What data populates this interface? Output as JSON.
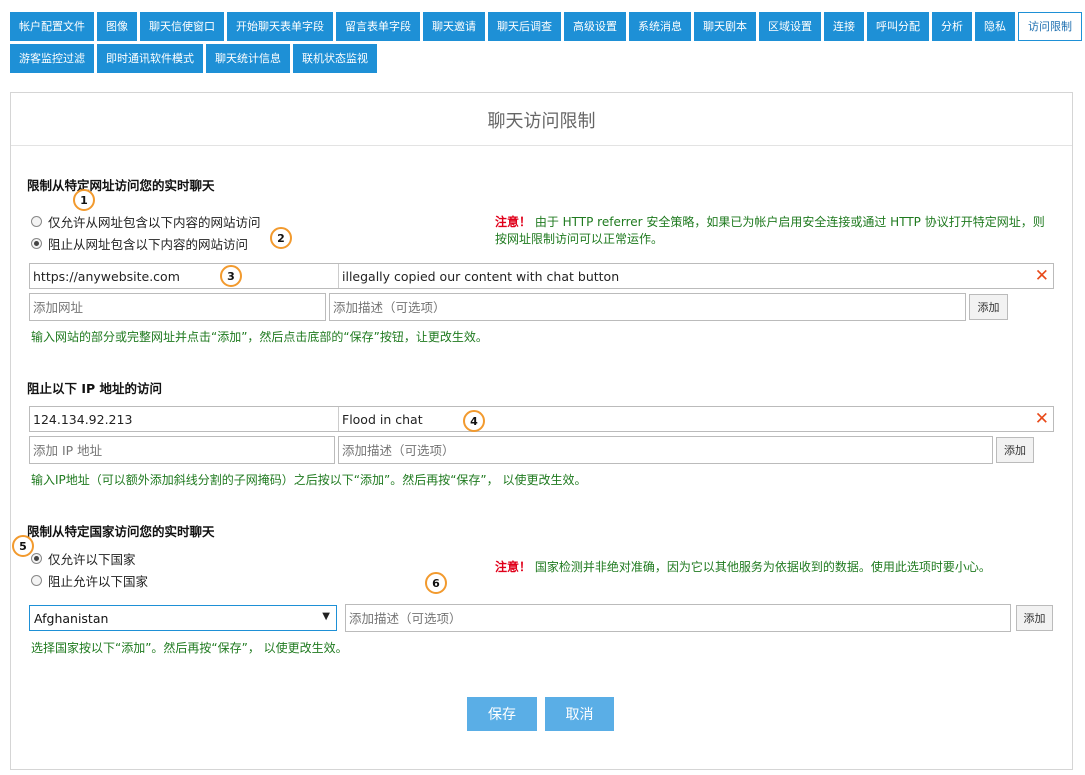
{
  "tabs_row1": [
    "帐户配置文件",
    "图像",
    "聊天信使窗口",
    "开始聊天表单字段",
    "留言表单字段",
    "聊天邀请",
    "聊天后调查",
    "高级设置",
    "系统消息",
    "聊天剧本",
    "区域设置",
    "连接",
    "呼叫分配",
    "分析",
    "隐私",
    "访问限制"
  ],
  "tabs_row2": [
    "游客监控过滤",
    "即时通讯软件模式",
    "聊天统计信息",
    "联机状态监视"
  ],
  "page_title": "聊天访问限制",
  "url_section": {
    "title": "限制从特定网址访问您的实时聊天",
    "option_allow": "仅允许从网址包含以下内容的网站访问",
    "option_block": "阻止从网址包含以下内容的网站访问",
    "note_warn": "注意！",
    "note_text": "由于 HTTP referrer 安全策略，如果已为帐户启用安全连接或通过 HTTP 协议打开特定网址，则按网址限制访问可以正常运作。",
    "entry_url": "https://anywebsite.com",
    "entry_desc": "illegally copied our content with chat button",
    "url_placeholder": "添加网址",
    "desc_placeholder": "添加描述（可选项）",
    "add_label": "添加",
    "help": "输入网站的部分或完整网址并点击“添加”，然后点击底部的“保存”按钮，让更改生效。"
  },
  "ip_section": {
    "title": "阻止以下 IP 地址的访问",
    "entry_ip": "124.134.92.213",
    "entry_desc": "Flood in chat",
    "ip_placeholder": "添加 IP 地址",
    "desc_placeholder": "添加描述（可选项）",
    "add_label": "添加",
    "help": "输入IP地址（可以额外添加斜线分割的子网掩码）之后按以下“添加”。然后再按“保存”， 以使更改生效。"
  },
  "country_section": {
    "title": "限制从特定国家访问您的实时聊天",
    "option_allow": "仅允许以下国家",
    "option_block": "阻止允许以下国家",
    "note_warn": "注意！",
    "note_text": "国家检测并非绝对准确，因为它以其他服务为依据收到的数据。使用此选项时要小心。",
    "selected_country": "Afghanistan",
    "desc_placeholder": "添加描述（可选项）",
    "add_label": "添加",
    "help": "选择国家按以下“添加”。然后再按“保存”， 以使更改生效。"
  },
  "save_label": "保存",
  "cancel_label": "取消",
  "delete_icon": "✕",
  "caret_icon": "▼",
  "markers": [
    "1",
    "2",
    "3",
    "4",
    "5",
    "6"
  ],
  "colors": {
    "tab_blue": "#1e90d6",
    "button_blue": "#5aaee6",
    "note_green": "#1f7a1f",
    "warn_red": "#e0001a",
    "marker_orange": "#f29a2e"
  }
}
